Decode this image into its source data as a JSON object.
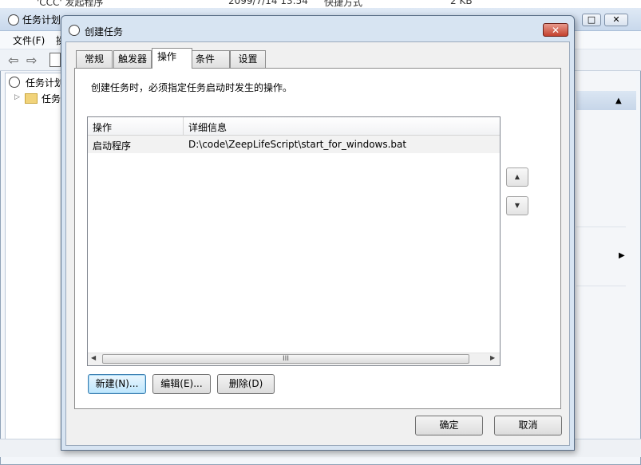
{
  "background_window": {
    "top_strip_texts": [
      "'CCC' 发起程序",
      "2099/7/14 13:54",
      "快捷方式",
      "2 KB"
    ],
    "title": "任务计划",
    "menu": [
      "文件(F)",
      "操"
    ],
    "tree_item": "任务计划",
    "tree_child": "任务",
    "controls": {
      "minimize": "—",
      "maximize": "□",
      "close": "✕"
    }
  },
  "dialog": {
    "title": "创建任务",
    "close_glyph": "✕",
    "tabs": [
      {
        "label": "常规",
        "selected": false
      },
      {
        "label": "触发器",
        "selected": false
      },
      {
        "label": "操作",
        "selected": true
      },
      {
        "label": "条件",
        "selected": false
      },
      {
        "label": "设置",
        "selected": false
      }
    ],
    "description": "创建任务时，必须指定任务启动时发生的操作。",
    "list": {
      "columns": [
        "操作",
        "详细信息"
      ],
      "rows": [
        {
          "action": "启动程序",
          "detail": "D:\\code\\ZeepLifeScript\\start_for_windows.bat"
        }
      ],
      "scroll_left": "◀",
      "scroll_right": "▶",
      "thumb_grip": "III"
    },
    "move_up": "▲",
    "move_down": "▼",
    "buttons": {
      "new": "新建(N)...",
      "edit": "编辑(E)...",
      "delete": "删除(D)"
    },
    "ok": "确定",
    "cancel": "取消"
  },
  "colors": {
    "dialog_frame": "#d7e4f2",
    "close_button": "#c4412e",
    "row_bg": "#f2f2f2"
  }
}
